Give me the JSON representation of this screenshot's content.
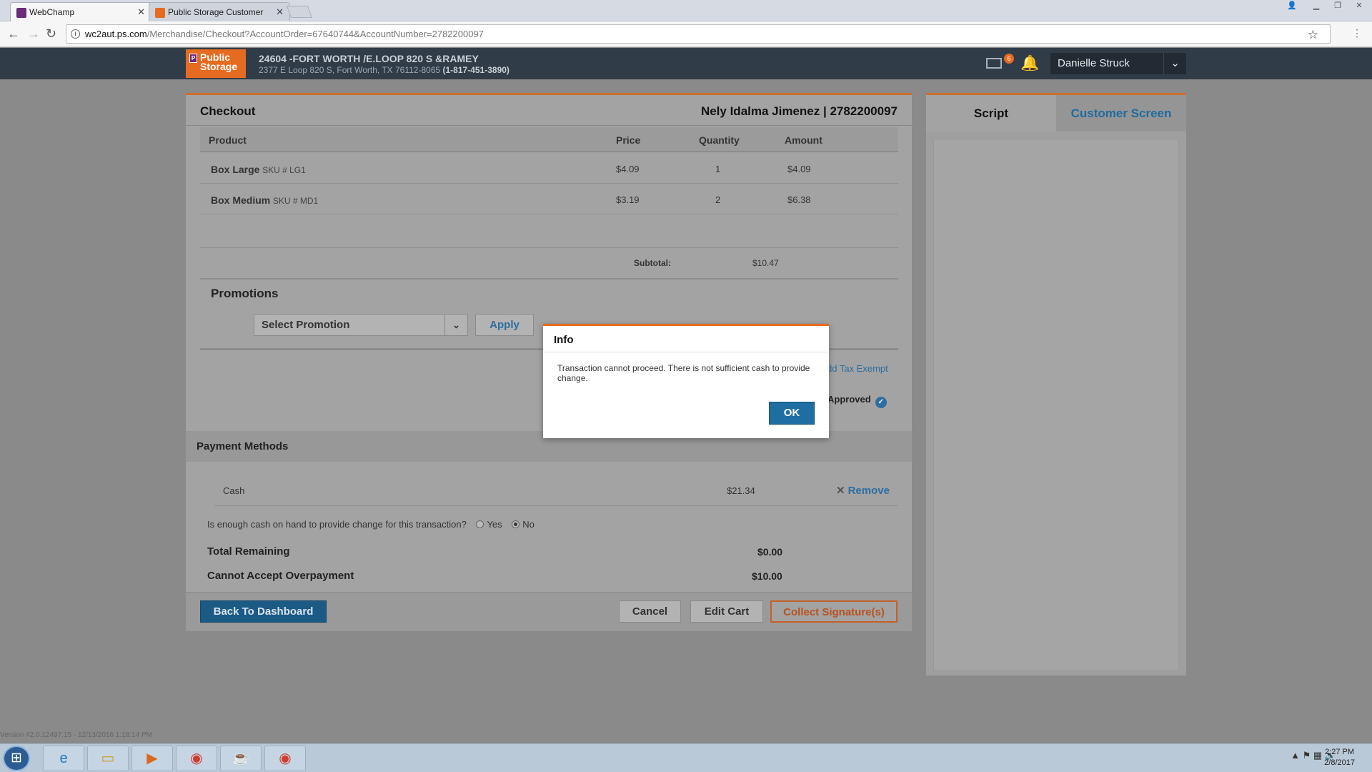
{
  "browser": {
    "tabs": [
      {
        "label": "WebChamp",
        "favicon_color": "#6a2b78"
      },
      {
        "label": "Public Storage Customer",
        "favicon_color": "#e56b20"
      }
    ],
    "url_host": "wc2aut.ps.com",
    "url_path": "/Merchandise/Checkout?AccountOrder=67640744&AccountNumber=2782200097"
  },
  "header": {
    "logo_line1": "Public",
    "logo_line2": "Storage",
    "store_name": "24604 -FORT WORTH /E.LOOP 820 S &RAMEY",
    "store_address": "2377 E Loop 820 S, Fort Worth, TX 76112-8065",
    "store_phone": "(1-817-451-3890)",
    "mail_count": "6",
    "user_name": "Danielle Struck"
  },
  "checkout": {
    "title": "Checkout",
    "customer": "Nely Idalma Jimenez | 2782200097",
    "columns": {
      "product": "Product",
      "price": "Price",
      "quantity": "Quantity",
      "amount": "Amount"
    },
    "items": [
      {
        "name": "Box Large",
        "sku": "SKU # LG1",
        "price": "$4.09",
        "quantity": "1",
        "amount": "$4.09"
      },
      {
        "name": "Box Medium",
        "sku": "SKU # MD1",
        "price": "$3.19",
        "quantity": "2",
        "amount": "$6.38"
      }
    ],
    "subtotal_label": "Subtotal:",
    "subtotal_value": "$10.47"
  },
  "promotions": {
    "heading": "Promotions",
    "select_value": "Select Promotion",
    "apply_label": "Apply",
    "tax_exempt_label": "dd Tax Exempt",
    "approved_label": "Approved"
  },
  "payment": {
    "heading": "Payment Methods",
    "method": "Cash",
    "method_amount": "$21.34",
    "remove_label": "Remove",
    "change_question": "Is enough cash on hand to provide change for this transaction?",
    "yes_label": "Yes",
    "no_label": "No",
    "selected_option": "No",
    "total_remaining_label": "Total Remaining",
    "total_remaining_value": "$0.00",
    "overpayment_label": "Cannot Accept Overpayment",
    "overpayment_value": "$10.00"
  },
  "footer": {
    "back_label": "Back To Dashboard",
    "cancel_label": "Cancel",
    "edit_label": "Edit Cart",
    "collect_label": "Collect Signature(s)"
  },
  "side_panel": {
    "tab_script": "Script",
    "tab_customer": "Customer Screen"
  },
  "version": "Version #2.0.12497.15 - 12/13/2016 1:18:14 PM",
  "modal": {
    "title": "Info",
    "message": "Transaction cannot proceed. There is not sufficient cash to provide change.",
    "ok_label": "OK"
  },
  "taskbar": {
    "time": "2:27 PM",
    "date": "2/8/2017"
  },
  "colors": {
    "brand_orange": "#e56b20",
    "link_blue": "#2c6ea0",
    "header_dark": "#303c48"
  }
}
